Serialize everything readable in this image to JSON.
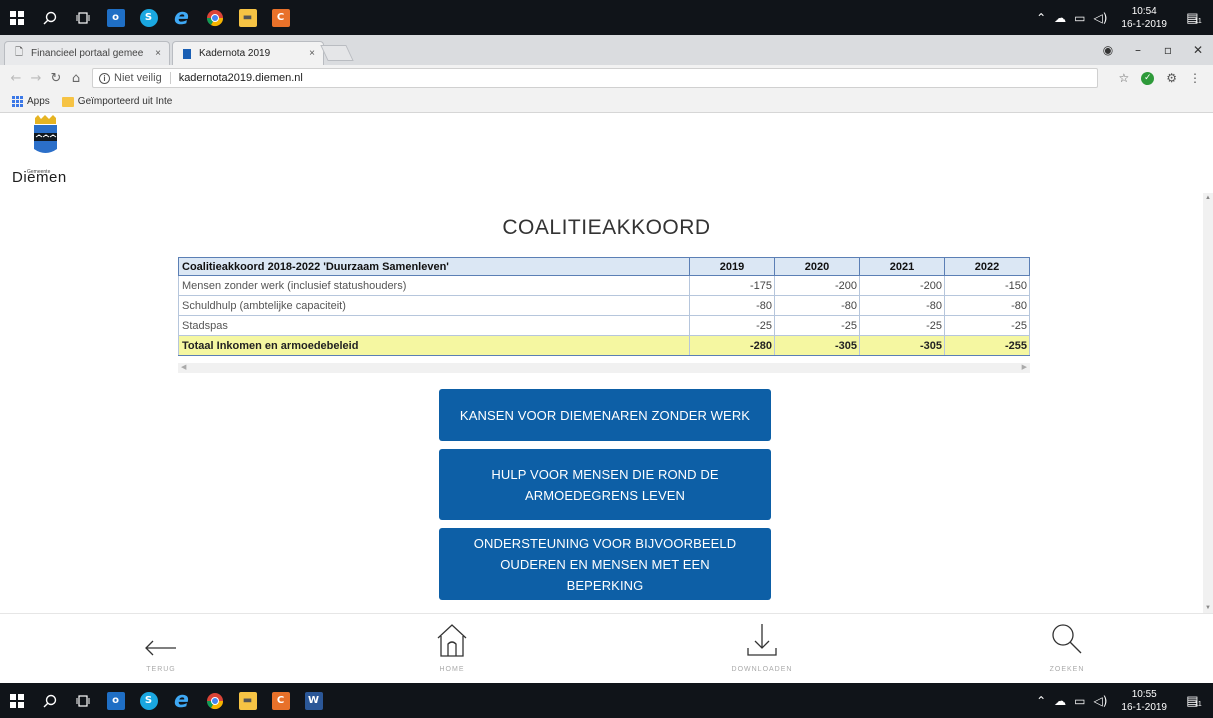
{
  "taskbar_top": {
    "time": "10:54",
    "date": "16-1-2019",
    "notification_count": "11"
  },
  "browser": {
    "tabs": [
      {
        "title": "Financieel portaal gemee",
        "close": "×"
      },
      {
        "title": "Kadernota 2019",
        "close": "×"
      }
    ],
    "security_label": "Niet veilig",
    "url": "kadernota2019.diemen.nl",
    "bookmarks": [
      "Apps",
      "Geïmporteerd uit Inte"
    ]
  },
  "logo": {
    "small": "Gemeente",
    "name": "Diemen"
  },
  "page": {
    "title": "COALITIEAKKOORD"
  },
  "table": {
    "header_label": "Coalitieakkoord 2018-2022 'Duurzaam Samenleven'",
    "years": [
      "2019",
      "2020",
      "2021",
      "2022"
    ],
    "rows": [
      {
        "label": "Mensen zonder werk (inclusief statushouders)",
        "values": [
          "-175",
          "-200",
          "-200",
          "-150"
        ]
      },
      {
        "label": "Schuldhulp (ambtelijke capaciteit)",
        "values": [
          "-80",
          "-80",
          "-80",
          "-80"
        ]
      },
      {
        "label": "Stadspas",
        "values": [
          "-25",
          "-25",
          "-25",
          "-25"
        ]
      }
    ],
    "total": {
      "label": "Totaal Inkomen en armoedebeleid",
      "values": [
        "-280",
        "-305",
        "-305",
        "-255"
      ]
    }
  },
  "buttons": {
    "btn1": "KANSEN VOOR DIEMENAREN ZONDER WERK",
    "btn2": "HULP VOOR MENSEN DIE ROND DE ARMOEDEGRENS LEVEN",
    "btn3": "ONDERSTEUNING VOOR BIJVOORBEELD OUDEREN EN MENSEN MET EEN BEPERKING"
  },
  "footer": {
    "back": "TERUG",
    "home": "HOME",
    "download": "DOWNLOADEN",
    "search": "ZOEKEN"
  },
  "taskbar_bottom": {
    "time": "10:55",
    "date": "16-1-2019",
    "notification_count": "11"
  },
  "colors": {
    "button_blue": "#0d5fa6",
    "total_row_yellow": "#f5f7a1",
    "table_header_blue": "#dbe7f4"
  }
}
